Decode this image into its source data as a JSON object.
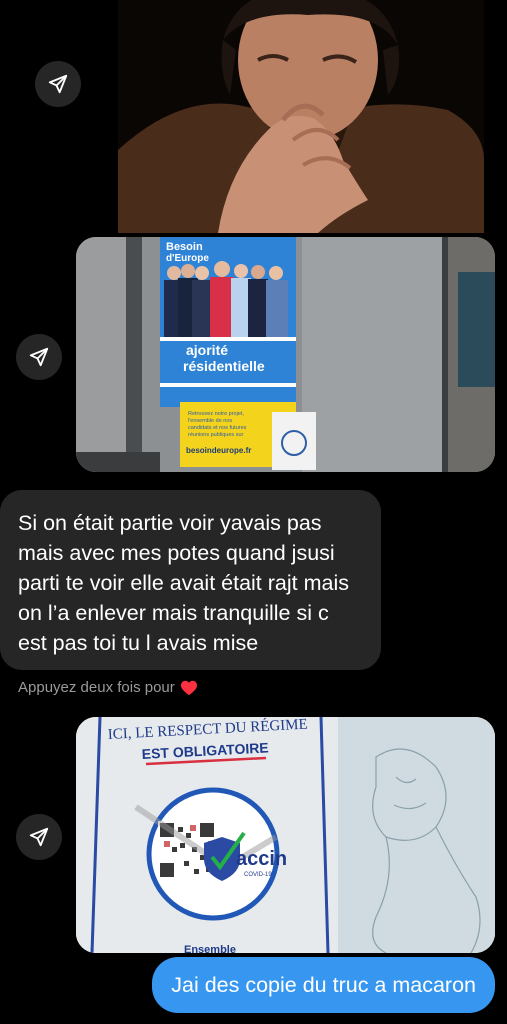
{
  "chat": {
    "messages": [
      {
        "type": "gif",
        "icon": "share-icon"
      },
      {
        "type": "image",
        "icon": "share-icon",
        "poster": {
          "heading": "Besoin\nd'Europe",
          "slogan_line1": "ajorité",
          "slogan_line2": "résidentielle",
          "body": "Retrouvez notre projet,\nl'ensemble de nos\ncandidats et nos futures\nréunions publiques sur",
          "url": "besoindeurope.fr"
        }
      },
      {
        "type": "text",
        "text": "Si on était partie voir yavais pas\nmais avec mes potes quand jsusi\nparti te voir elle avait était rajt mais\non l’a enlever mais tranquille si c\nest pas toi tu l avais mise"
      },
      {
        "type": "image",
        "icon": "share-icon",
        "poster": {
          "line1": "ICI, LE RESPECT DU RÉGIME",
          "line2": "EST OBLIGATOIRE",
          "badge_word": "accin",
          "badge_sub": "COVID-19",
          "footer": "Ensemble"
        }
      }
    ],
    "like_hint": "Appuyez deux fois pour",
    "like_icon": "heart-icon",
    "sent_message": "Jai des copie du truc a macaron"
  },
  "colors": {
    "background": "#000000",
    "received_bubble": "#262626",
    "sent_bubble": "#3797f0",
    "heart": "#ff3040",
    "hint_text": "#9a9a9a"
  }
}
